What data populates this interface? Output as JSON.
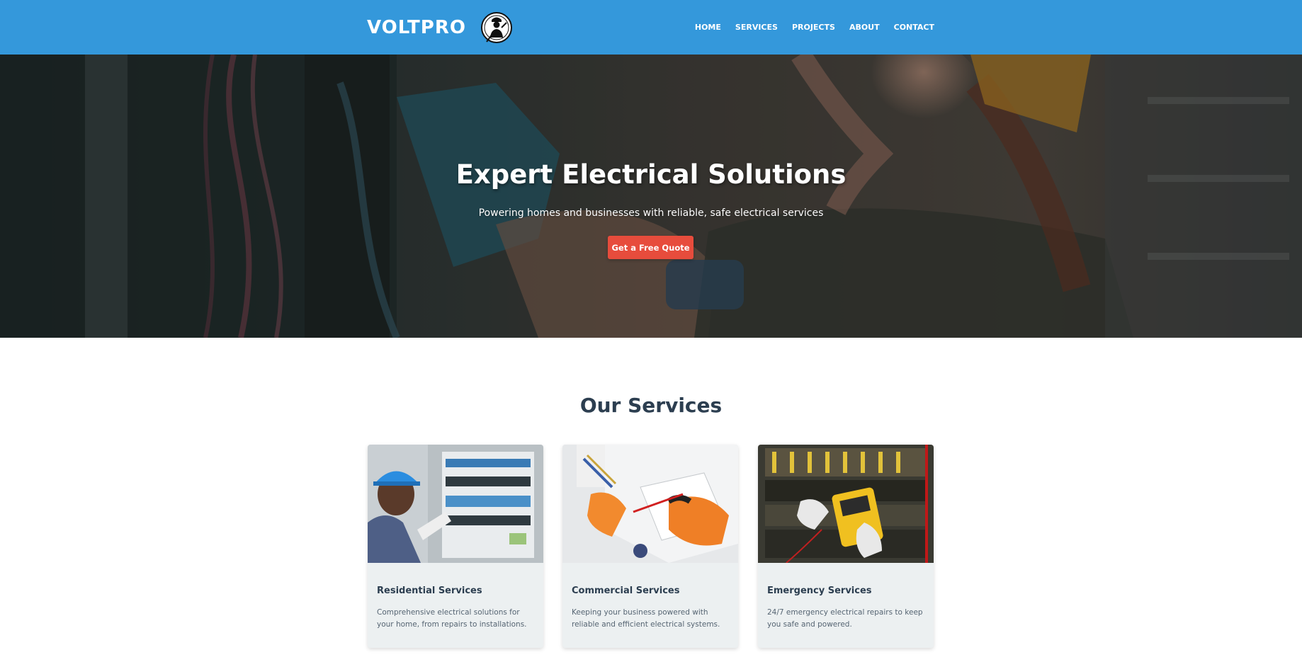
{
  "header": {
    "brand_name": "VOLTPRO",
    "logo_icon": "electrician-silhouette-icon",
    "nav": [
      {
        "label": "HOME"
      },
      {
        "label": "SERVICES"
      },
      {
        "label": "PROJECTS"
      },
      {
        "label": "ABOUT"
      },
      {
        "label": "CONTACT"
      }
    ],
    "background_color": "#3498db"
  },
  "hero": {
    "title": "Expert Electrical Solutions",
    "subtitle": "Powering homes and businesses with reliable, safe electrical services",
    "cta_label": "Get a Free Quote",
    "cta_color": "#e74c3c"
  },
  "services": {
    "title": "Our Services",
    "cards": [
      {
        "title": "Residential Services",
        "description": "Comprehensive electrical solutions for your home, from repairs to installations."
      },
      {
        "title": "Commercial Services",
        "description": "Keeping your business powered with reliable and efficient electrical systems."
      },
      {
        "title": "Emergency Services",
        "description": "24/7 emergency electrical repairs to keep you safe and powered."
      }
    ]
  }
}
